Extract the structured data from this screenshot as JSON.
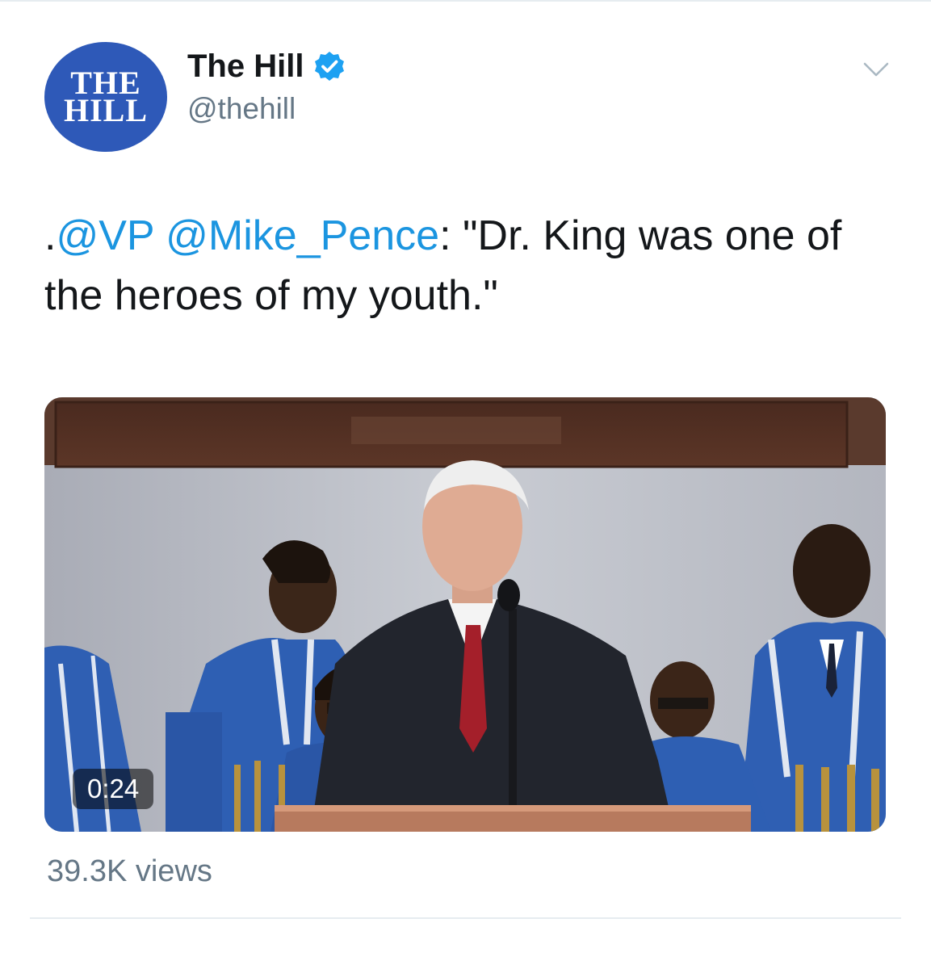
{
  "account": {
    "avatar_line1": "THE",
    "avatar_line2": "HILL",
    "display_name": "The Hill",
    "handle": "@thehill",
    "verified": true,
    "avatar_color": "#2e59b8",
    "verified_color": "#1da1f2"
  },
  "tweet": {
    "prefix": ".",
    "mention_1": "@VP",
    "space": " ",
    "mention_2": "@Mike_Pence",
    "body": ": \"Dr. King was one of the heroes of my youth.\"",
    "link_color": "#1b95e0"
  },
  "media": {
    "duration": "0:24"
  },
  "stats": {
    "views": "39.3K views"
  },
  "icons": {
    "menu": "chevron-down-icon",
    "verified": "verified-badge-icon"
  }
}
